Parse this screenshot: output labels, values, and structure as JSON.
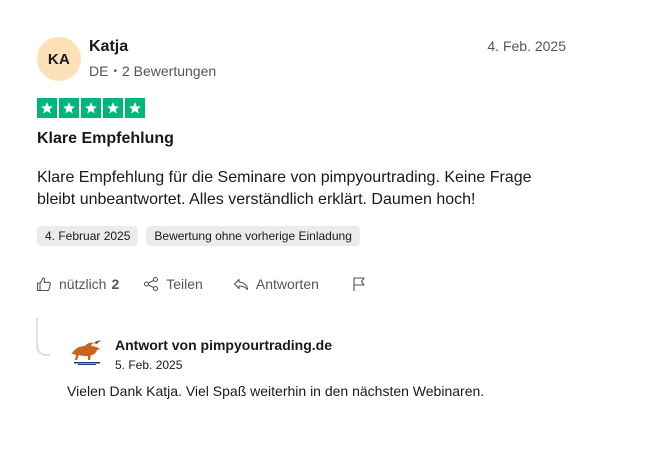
{
  "reviewer": {
    "initials": "KA",
    "name": "Katja",
    "country": "DE",
    "review_count": "2 Bewertungen"
  },
  "review": {
    "date": "4. Feb. 2025",
    "rating": 5,
    "star_color": "#00b67a",
    "title": "Klare Empfehlung",
    "body": "Klare Empfehlung für die Seminare von pimpyourtrading. Keine Frage bleibt unbeantwortet. Alles verständlich erklärt. Daumen hoch!",
    "tags": [
      "4. Februar 2025",
      "Bewertung ohne vorherige Einladung"
    ]
  },
  "actions": {
    "useful_label": "nützlich",
    "useful_count": "2",
    "share_label": "Teilen",
    "reply_label": "Antworten",
    "report_icon": "flag-icon"
  },
  "reply": {
    "company": "Antwort von pimpyourtrading.de",
    "date": "5. Feb. 2025",
    "text": "Vielen Dank Katja. Viel Spaß weiterhin in den nächsten Webinaren."
  }
}
